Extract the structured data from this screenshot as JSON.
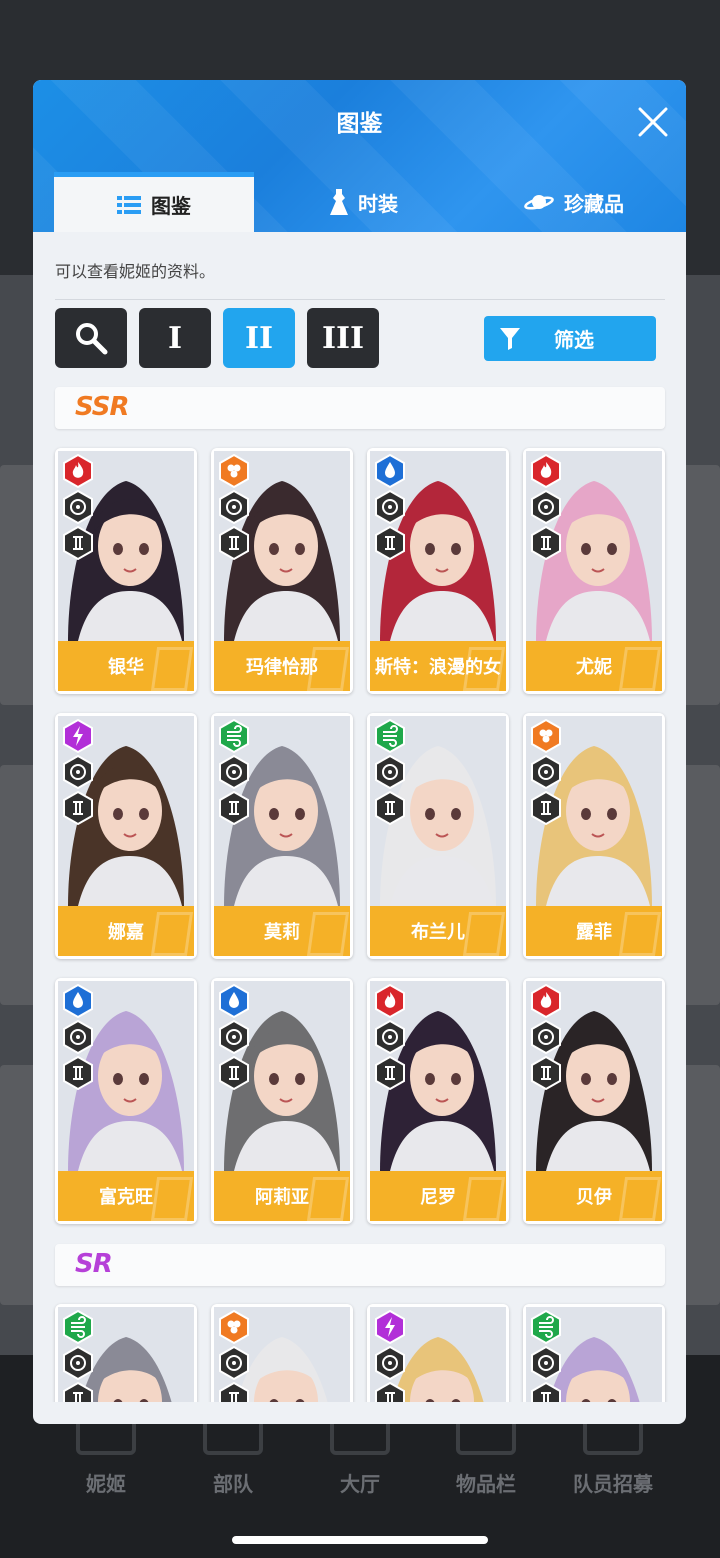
{
  "background": {
    "nav": [
      "妮姬",
      "部队",
      "大厅",
      "物品栏",
      "队员招募"
    ]
  },
  "modal": {
    "title": "图鉴",
    "tabs": [
      {
        "label": "图鉴",
        "icon": "list-icon",
        "active": true
      },
      {
        "label": "时装",
        "icon": "dress-icon",
        "active": false
      },
      {
        "label": "珍藏品",
        "icon": "saturn-icon",
        "active": false
      }
    ],
    "description": "可以查看妮姬的资料。",
    "toolbar": {
      "burst_buttons": [
        "I",
        "II",
        "III"
      ],
      "selected": "II",
      "filter_label": "筛选"
    },
    "sections": [
      {
        "rarity": "SSR",
        "cards": [
          {
            "name": "银华",
            "element": "fire",
            "weapon": "sniper",
            "burst": "II"
          },
          {
            "name": "玛律恰那",
            "element": "iron",
            "weapon": "shotgun",
            "burst": "II"
          },
          {
            "name": "斯特：浪漫的女",
            "element": "water",
            "weapon": "rocket",
            "burst": "II"
          },
          {
            "name": "尤妮",
            "element": "fire",
            "weapon": "smg",
            "burst": "II"
          },
          {
            "name": "娜嘉",
            "element": "electric",
            "weapon": "shotgun",
            "burst": "II"
          },
          {
            "name": "莫莉",
            "element": "wind",
            "weapon": "assault",
            "burst": "II"
          },
          {
            "name": "布兰儿",
            "element": "wind",
            "weapon": "assault",
            "burst": "II"
          },
          {
            "name": "露菲",
            "element": "iron",
            "weapon": "assault",
            "burst": "II"
          },
          {
            "name": "富克旺",
            "element": "water",
            "weapon": "assault",
            "burst": "II"
          },
          {
            "name": "阿莉亚",
            "element": "water",
            "weapon": "rocket",
            "burst": "II"
          },
          {
            "name": "尼罗",
            "element": "fire",
            "weapon": "mg",
            "burst": "II"
          },
          {
            "name": "贝伊",
            "element": "fire",
            "weapon": "smg",
            "burst": "II"
          }
        ]
      },
      {
        "rarity": "SR",
        "cards": [
          {
            "name": "",
            "element": "wind",
            "weapon": "sniper",
            "burst": "II"
          },
          {
            "name": "",
            "element": "iron",
            "weapon": "smg",
            "burst": "II"
          },
          {
            "name": "",
            "element": "electric",
            "weapon": "smg",
            "burst": "II"
          },
          {
            "name": "",
            "element": "wind",
            "weapon": "mg",
            "burst": "II"
          }
        ]
      }
    ]
  },
  "colors": {
    "accent": "#22a5ee",
    "namebar": "#f5b127",
    "fire": "#d9262b",
    "iron": "#f07a22",
    "water": "#1e6fd6",
    "electric": "#b22fd8",
    "wind": "#1fa84a",
    "ssr": "#f07a22",
    "sr": "#b640d8"
  }
}
